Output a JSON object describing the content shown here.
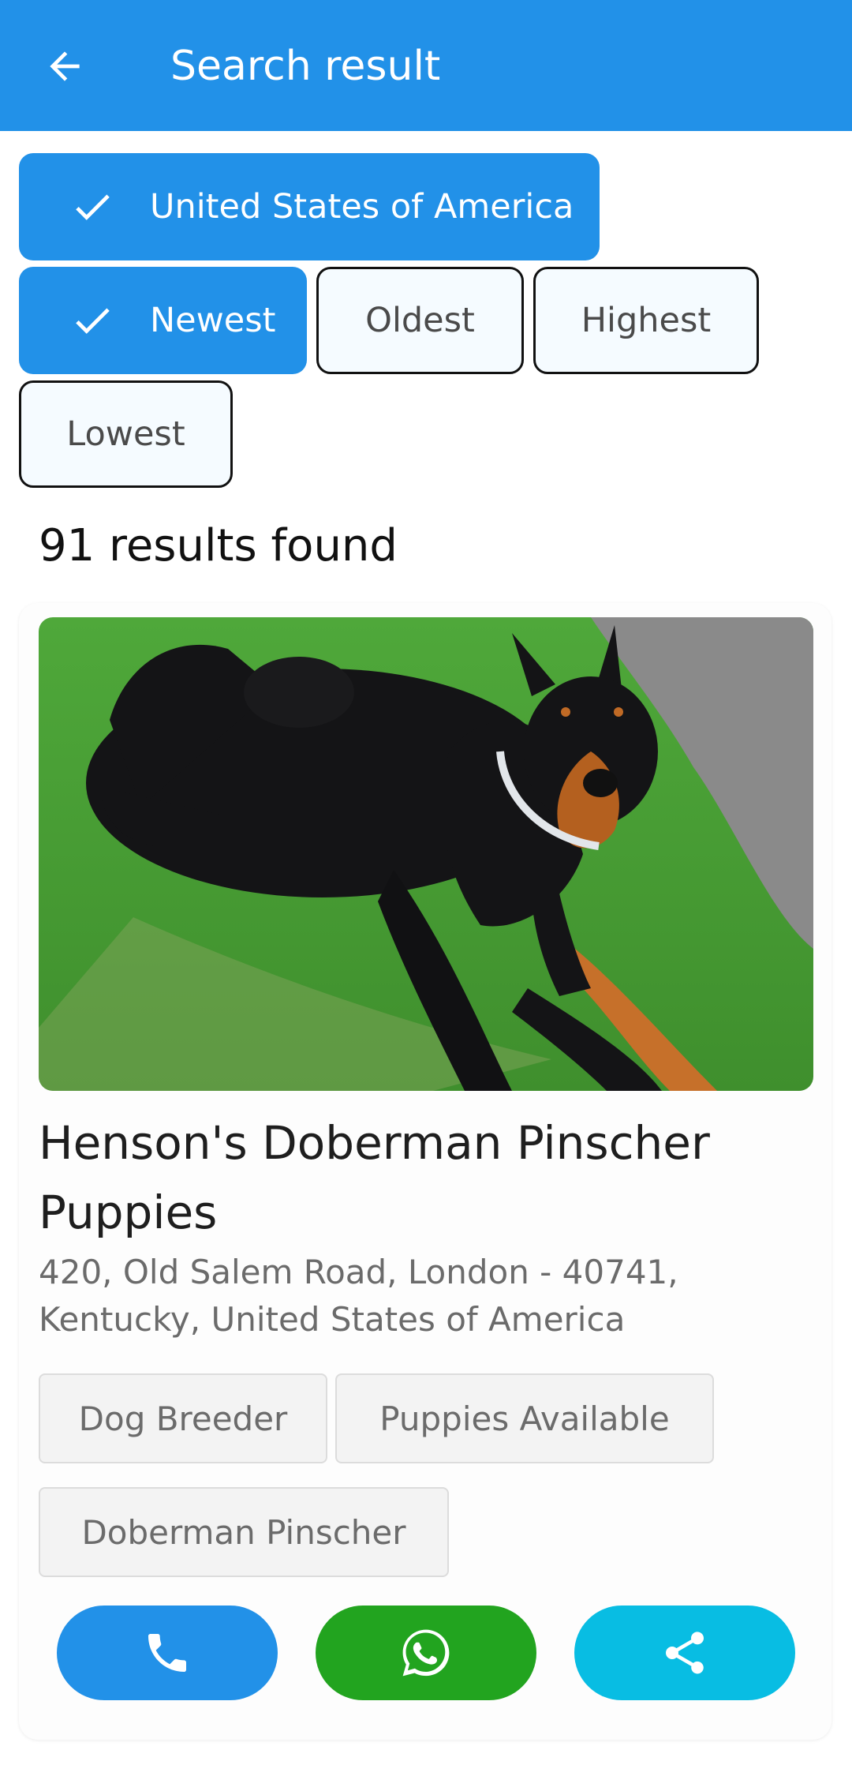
{
  "header": {
    "title": "Search result",
    "back_icon": "arrow-left-icon"
  },
  "filters": {
    "location": {
      "label": "United States of America",
      "selected": true
    },
    "sort": [
      {
        "label": "Newest",
        "selected": true
      },
      {
        "label": "Oldest",
        "selected": false
      },
      {
        "label": "Highest",
        "selected": false
      },
      {
        "label": "Lowest",
        "selected": false
      }
    ]
  },
  "results": {
    "count_text": "91 results found"
  },
  "listing": {
    "title": "Henson's Doberman Pinscher Puppies",
    "address": "420, Old Salem Road, London - 40741, Kentucky, United States of America",
    "tags": [
      "Dog Breeder",
      "Puppies Available",
      "Doberman Pinscher"
    ],
    "actions": [
      {
        "icon": "phone-icon",
        "color": "#2291e8"
      },
      {
        "icon": "whatsapp-icon",
        "color": "#22a41f"
      },
      {
        "icon": "share-icon",
        "color": "#08bde3"
      }
    ]
  },
  "colors": {
    "primary": "#2291e8",
    "whatsapp": "#22a41f",
    "share": "#08bde3"
  }
}
